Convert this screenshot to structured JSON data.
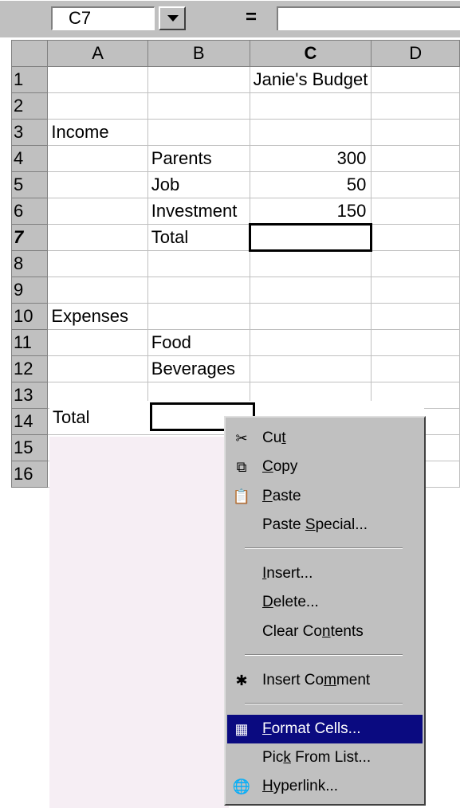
{
  "formula_bar": {
    "name_box": "C7",
    "equals": "="
  },
  "columns": [
    "A",
    "B",
    "C",
    "D"
  ],
  "rows": [
    {
      "num": "1",
      "a": "",
      "b": "",
      "c": "Janie's Budget",
      "c_num": false
    },
    {
      "num": "2",
      "a": "",
      "b": "",
      "c": ""
    },
    {
      "num": "3",
      "a": "Income",
      "b": "",
      "c": ""
    },
    {
      "num": "4",
      "a": "",
      "b": "Parents",
      "c": "300",
      "c_num": true
    },
    {
      "num": "5",
      "a": "",
      "b": "Job",
      "c": "50",
      "c_num": true
    },
    {
      "num": "6",
      "a": "",
      "b": "Investment",
      "c": "150",
      "c_num": true
    },
    {
      "num": "7",
      "a": "",
      "b": "Total",
      "c": ""
    },
    {
      "num": "8",
      "a": "",
      "b": "",
      "c": ""
    },
    {
      "num": "9",
      "a": "",
      "b": "",
      "c": ""
    },
    {
      "num": "10",
      "a": "Expenses",
      "b": "",
      "c": ""
    },
    {
      "num": "11",
      "a": "",
      "b": "Food",
      "c": ""
    },
    {
      "num": "12",
      "a": "",
      "b": "Beverages",
      "c": ""
    },
    {
      "num": "13",
      "a": "",
      "b": "",
      "c": ""
    },
    {
      "num": "14",
      "a": "",
      "b": "",
      "c": ""
    },
    {
      "num": "15",
      "a": "",
      "b": "",
      "c": ""
    },
    {
      "num": "16",
      "a": "",
      "b": "",
      "c": ""
    }
  ],
  "shifted": {
    "total_label": "Total"
  },
  "context_menu": {
    "items": [
      {
        "label_pre": "Cu",
        "label_ul": "t",
        "label_post": "",
        "icon": "scissors-icon"
      },
      {
        "label_pre": "",
        "label_ul": "C",
        "label_post": "opy",
        "icon": "copy-icon"
      },
      {
        "label_pre": "",
        "label_ul": "P",
        "label_post": "aste",
        "icon": "paste-icon"
      },
      {
        "label_pre": "Paste ",
        "label_ul": "S",
        "label_post": "pecial...",
        "icon": ""
      },
      {
        "label_pre": "",
        "label_ul": "I",
        "label_post": "nsert...",
        "icon": ""
      },
      {
        "label_pre": "",
        "label_ul": "D",
        "label_post": "elete...",
        "icon": ""
      },
      {
        "label_pre": "Clear Co",
        "label_ul": "n",
        "label_post": "tents",
        "icon": ""
      },
      {
        "label_pre": "Insert Co",
        "label_ul": "m",
        "label_post": "ment",
        "icon": "insert-comment-icon"
      },
      {
        "label_pre": "",
        "label_ul": "F",
        "label_post": "ormat Cells...",
        "icon": "format-cells-icon"
      },
      {
        "label_pre": "Pic",
        "label_ul": "k",
        "label_post": " From List...",
        "icon": ""
      },
      {
        "label_pre": "",
        "label_ul": "H",
        "label_post": "yperlink...",
        "icon": "hyperlink-icon"
      }
    ],
    "highlighted_index": 8
  }
}
